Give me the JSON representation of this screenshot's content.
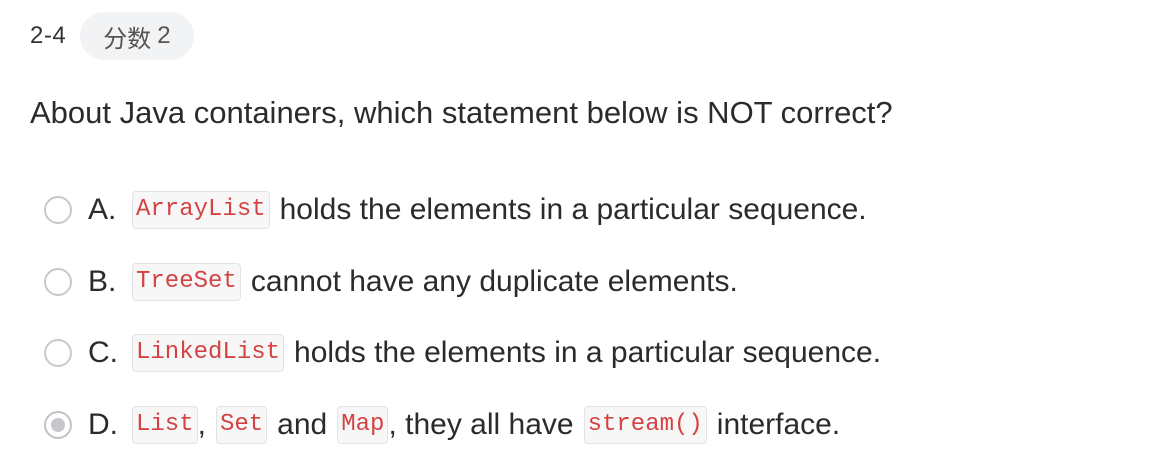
{
  "question": {
    "number": "2-4",
    "score_label": "分数",
    "score_value": "2",
    "text": "About Java containers, which statement below is NOT correct?"
  },
  "options": [
    {
      "letter": "A.",
      "code1": "ArrayList",
      "text1": "holds the elements in a particular sequence.",
      "selected": false
    },
    {
      "letter": "B.",
      "code1": "TreeSet",
      "text1": "cannot have any duplicate elements.",
      "selected": false
    },
    {
      "letter": "C.",
      "code1": "LinkedList",
      "text1": "holds the elements in a particular sequence.",
      "selected": false
    },
    {
      "letter": "D.",
      "code1": "List",
      "sep1": ",",
      "code2": "Set",
      "text2": "and",
      "code3": "Map",
      "text3": ", they all have",
      "code4": "stream()",
      "text4": "interface.",
      "selected": true
    }
  ],
  "colors": {
    "code_text": "#d44343",
    "code_bg": "#f7f7f8",
    "badge_bg": "#f2f3f5",
    "radio_border": "#c9c9cf",
    "radio_selected_dot": "#c6c6cc"
  }
}
